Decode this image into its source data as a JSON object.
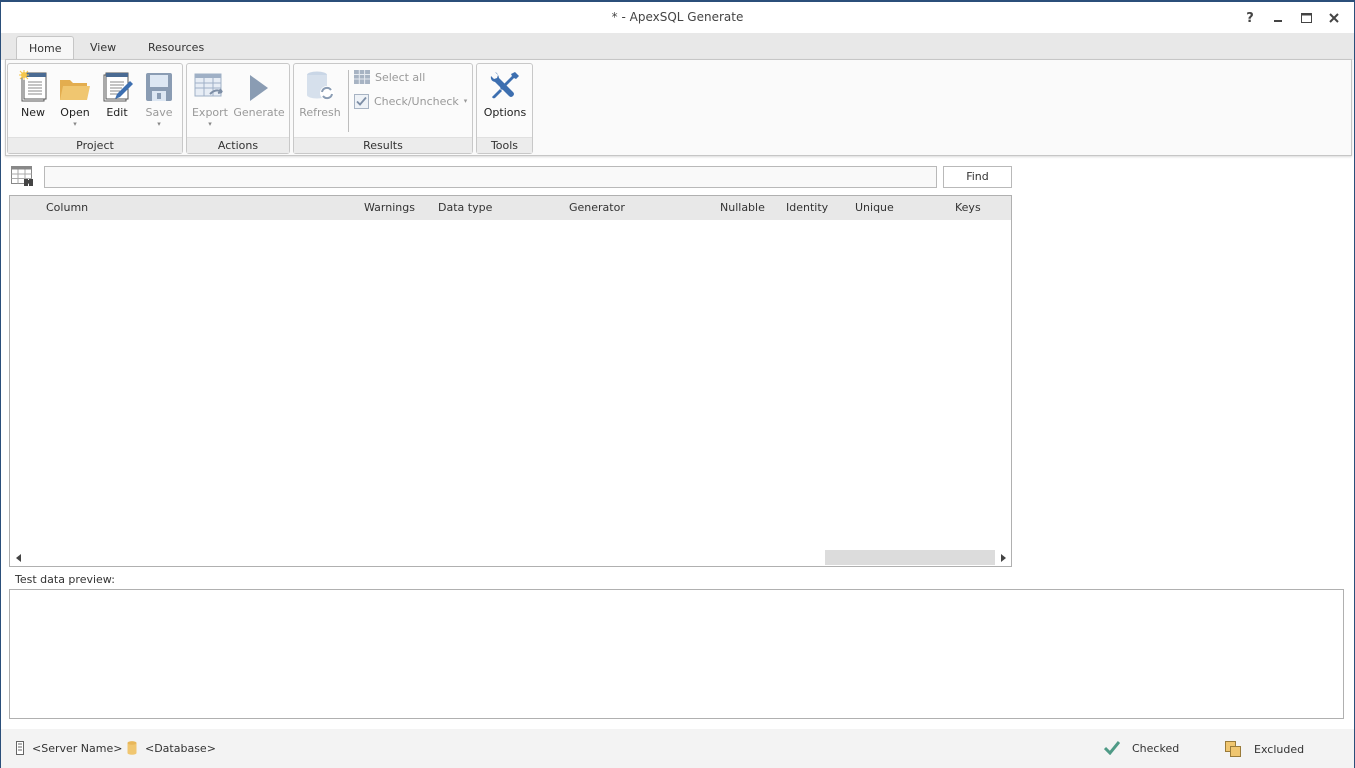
{
  "window": {
    "title": "* - ApexSQL Generate",
    "controls": [
      {
        "name": "help",
        "glyph": "?"
      },
      {
        "name": "minimize",
        "glyph": "_"
      },
      {
        "name": "maximize",
        "glyph": "□"
      },
      {
        "name": "close",
        "glyph": "×"
      }
    ]
  },
  "ribbon": {
    "tabs": [
      {
        "label": "Home",
        "active": true
      },
      {
        "label": "View",
        "active": false
      },
      {
        "label": "Resources",
        "active": false
      }
    ],
    "groups": {
      "project": {
        "label": "Project",
        "buttons": [
          {
            "label": "New",
            "icon": "new-project-icon",
            "enabled": true
          },
          {
            "label": "Open",
            "icon": "open-folder-icon",
            "enabled": true,
            "dropdown": true
          },
          {
            "label": "Edit",
            "icon": "edit-project-icon",
            "enabled": true
          },
          {
            "label": "Save",
            "icon": "save-disk-icon",
            "enabled": false,
            "dropdown": true
          }
        ]
      },
      "actions": {
        "label": "Actions",
        "buttons": [
          {
            "label": "Export",
            "icon": "export-table-icon",
            "enabled": false,
            "dropdown": true
          },
          {
            "label": "Generate",
            "icon": "play-icon",
            "enabled": false
          }
        ]
      },
      "results": {
        "label": "Results",
        "buttons": [
          {
            "label": "Refresh",
            "icon": "refresh-database-icon",
            "enabled": false
          },
          {
            "label": "Select all",
            "icon": "grid-select-icon",
            "enabled": false
          },
          {
            "label": "Check/Uncheck",
            "icon": "checkbox-icon",
            "enabled": false,
            "dropdown": true
          }
        ]
      },
      "tools": {
        "label": "Tools",
        "buttons": [
          {
            "label": "Options",
            "icon": "wrench-screwdriver-icon",
            "enabled": true
          }
        ]
      }
    }
  },
  "find": {
    "value": "",
    "placeholder": "",
    "button_label": "Find"
  },
  "grid": {
    "columns": [
      "Column",
      "Warnings",
      "Data type",
      "Generator",
      "Nullable",
      "Identity",
      "Unique",
      "Keys"
    ],
    "rows": []
  },
  "preview": {
    "label": "Test data preview:"
  },
  "statusbar": {
    "server": "<Server Name>",
    "database": "<Database>",
    "checked": "Checked",
    "excluded": "Excluded"
  },
  "colors": {
    "accent_blue": "#2b4f7a",
    "icon_blue": "#4a7ab5",
    "folder_yellow": "#e8b75a",
    "check_green": "#4f9a86"
  }
}
